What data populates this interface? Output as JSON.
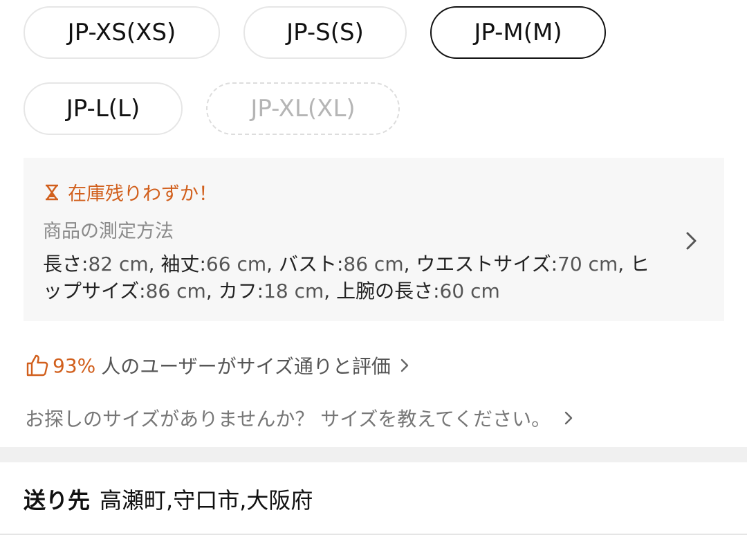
{
  "sizes": [
    {
      "label": "JP-XS(XS)",
      "state": "normal"
    },
    {
      "label": "JP-S(S)",
      "state": "normal"
    },
    {
      "label": "JP-M(M)",
      "state": "selected"
    },
    {
      "label": "JP-L(L)",
      "state": "normal"
    },
    {
      "label": "JP-XL(XL)",
      "state": "disabled"
    }
  ],
  "stock_warning": "在庫残りわずか！",
  "measure_method": "商品の測定方法",
  "measurements": [
    {
      "key": "長さ",
      "value": "82 cm"
    },
    {
      "key": "袖丈",
      "value": "66 cm"
    },
    {
      "key": "バスト",
      "value": "86 cm"
    },
    {
      "key": "ウエストサイズ",
      "value": "70 cm"
    },
    {
      "key": "ヒップサイズ",
      "value": "86 cm"
    },
    {
      "key": "カフ",
      "value": "18 cm"
    },
    {
      "key": "上腕の長さ",
      "value": "60 cm"
    }
  ],
  "fit": {
    "percent": "93%",
    "text": "人のユーザーがサイズ通りと評価"
  },
  "ask_size": "お探しのサイズがありませんか？ サイズを教えてください。",
  "shipping": {
    "label": "送り先",
    "address": "高瀬町,守口市,大阪府"
  },
  "colors": {
    "accent": "#d15f1c",
    "selected_border": "#111111",
    "panel_bg": "#f7f7f7"
  },
  "icons": {
    "stock": "hourglass-icon",
    "fit": "thumbs-up-icon",
    "arrow": "chevron-right-icon"
  }
}
